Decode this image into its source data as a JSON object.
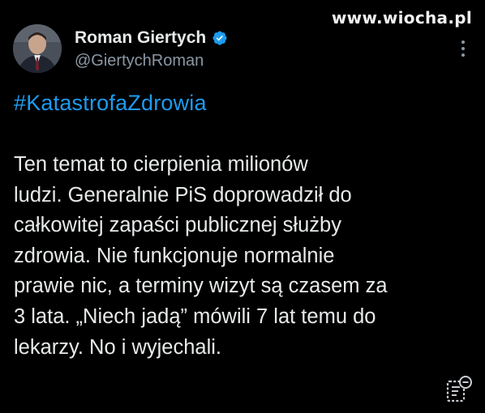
{
  "watermark": "www.wiocha.pl",
  "author": {
    "display_name": "Roman Giertych",
    "handle": "@GiertychRoman",
    "verified_icon": "verified-badge-icon",
    "avatar": "avatar-photo"
  },
  "tweet": {
    "hashtag": "#KatastrofaZdrowia",
    "text": "Ten temat to cierpienia milionów\nludzi. Generalnie PiS doprowadził do\ncałkowitej zapaści publicznej służby\nzdrowia. Nie funkcjonuje normalnie\nprawie nic, a terminy wizyt są czasem za\n3 lata. „Niech jadą” mówili 7 lat temu do\nlekarzy. No i wyjechali."
  },
  "icons": {
    "more": "more-options-icon",
    "translate": "post-translate-icon"
  },
  "colors": {
    "background": "#000000",
    "text": "#e7e9ea",
    "secondary_text": "#8b98a5",
    "link": "#1d9bf0",
    "verified": "#1d9bf0"
  }
}
